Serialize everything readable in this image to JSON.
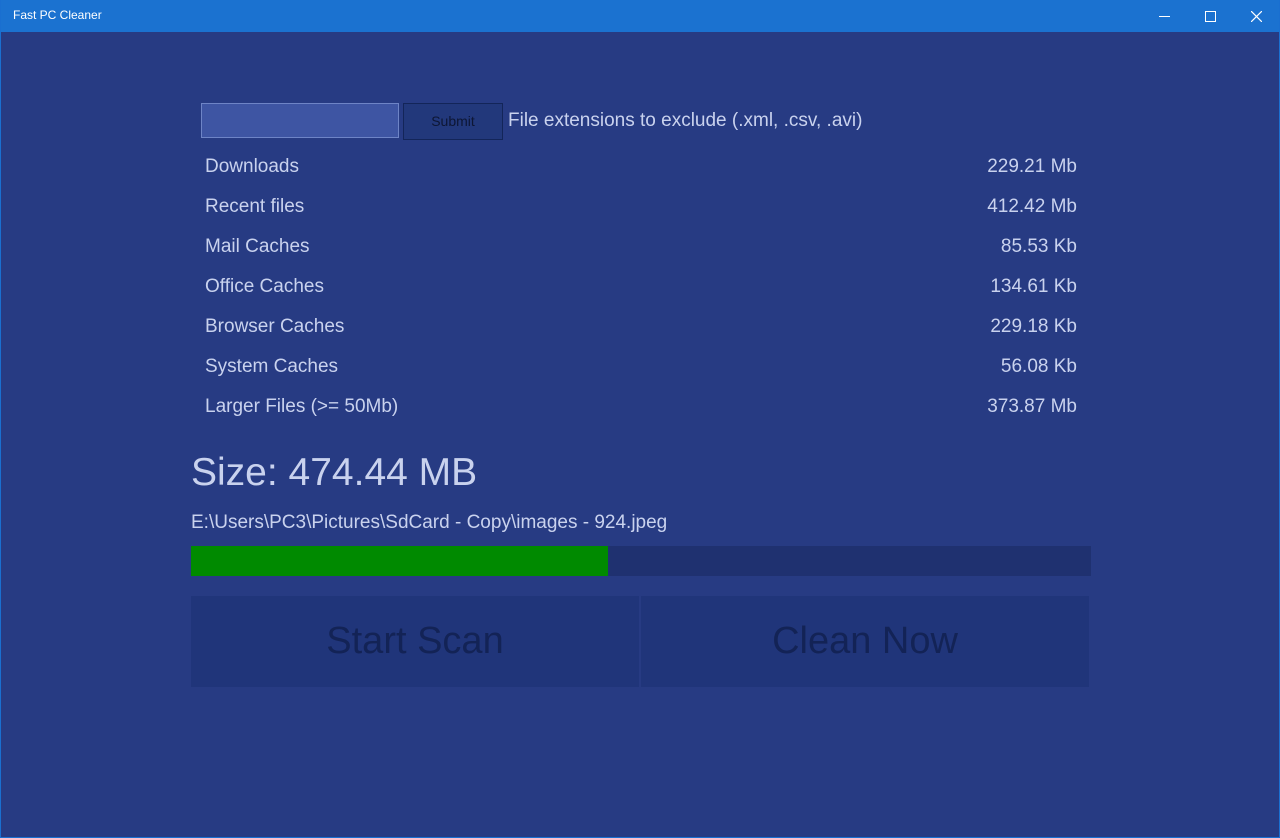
{
  "window": {
    "title": "Fast PC Cleaner"
  },
  "exclude": {
    "input_value": "",
    "submit_label": "Submit",
    "label": "File extensions to exclude (.xml, .csv, .avi)"
  },
  "items": [
    {
      "label": "Downloads",
      "size": "229.21 Mb"
    },
    {
      "label": "Recent files",
      "size": "412.42 Mb"
    },
    {
      "label": "Mail Caches",
      "size": "85.53 Kb"
    },
    {
      "label": "Office Caches",
      "size": "134.61 Kb"
    },
    {
      "label": "Browser Caches",
      "size": "229.18 Kb"
    },
    {
      "label": "System Caches",
      "size": "56.08 Kb"
    },
    {
      "label": "Larger Files (>= 50Mb)",
      "size": "373.87 Mb"
    }
  ],
  "summary": {
    "size_text": "Size: 474.44 MB",
    "current_file": "E:\\Users\\PC3\\Pictures\\SdCard - Copy\\images - 924.jpeg",
    "progress_percent": 46.3
  },
  "actions": {
    "start_label": "Start Scan",
    "clean_label": "Clean Now"
  },
  "colors": {
    "background": "#273b83",
    "titlebar": "#1b72d0",
    "progress_fill": "#008a00"
  },
  "icons": {
    "minimize": "minimize-icon",
    "maximize": "maximize-icon",
    "close": "close-icon"
  }
}
